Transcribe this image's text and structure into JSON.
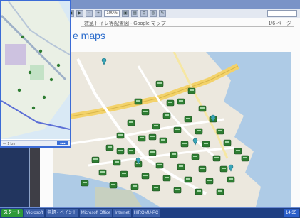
{
  "pdf_window": {
    "toolbar": {
      "zoom": "100%"
    },
    "document_header": "救急トイレ等配置図 - Google マップ",
    "page_indicator": "1/6 ページ",
    "page_title": "e maps"
  },
  "map": {
    "pin_icon": "map-pin-icon",
    "marker_icon": "toilet-marker-icon"
  },
  "overlay": {
    "scale_text": "— 1 km"
  },
  "taskbar": {
    "items": [
      "スタート",
      "Microsoft",
      "無題 - ペイント",
      "Microsoft Office",
      "Internet",
      "HIROMU-PC"
    ],
    "tray_time": "14:35"
  },
  "colors": {
    "water": "#aecbe6",
    "land": "#ece8de",
    "road_main": "#f3d26a",
    "marker_green": "#2e7d32",
    "desktop": "#22355f"
  }
}
